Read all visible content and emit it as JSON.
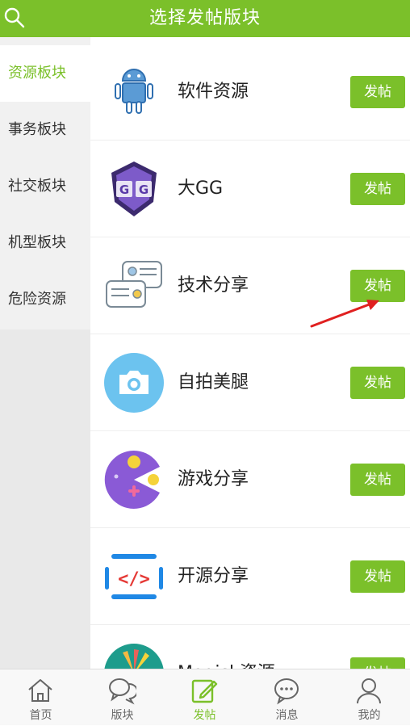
{
  "header": {
    "title": "选择发帖版块",
    "search_icon": "search-icon"
  },
  "sidebar": {
    "items": [
      {
        "label": "资源板块",
        "active": true
      },
      {
        "label": "事务板块",
        "active": false
      },
      {
        "label": "社交板块",
        "active": false
      },
      {
        "label": "机型板块",
        "active": false
      },
      {
        "label": "危险资源",
        "active": false
      }
    ]
  },
  "sections": [
    {
      "label": "软件资源",
      "icon": "android-icon",
      "button": "发帖"
    },
    {
      "label": "大GG",
      "icon": "gg-shield-icon",
      "button": "发帖"
    },
    {
      "label": "技术分享",
      "icon": "chat-cards-icon",
      "button": "发帖"
    },
    {
      "label": "自拍美腿",
      "icon": "camera-icon",
      "button": "发帖"
    },
    {
      "label": "游戏分享",
      "icon": "pacman-icon",
      "button": "发帖"
    },
    {
      "label": "开源分享",
      "icon": "code-icon",
      "button": "发帖"
    },
    {
      "label": "Magisk资源",
      "icon": "magisk-icon",
      "button": "发帖"
    }
  ],
  "tabbar": {
    "items": [
      {
        "label": "首页",
        "icon": "home-icon",
        "active": false
      },
      {
        "label": "版块",
        "icon": "chat-bubbles-icon",
        "active": false
      },
      {
        "label": "发帖",
        "icon": "edit-icon",
        "active": true
      },
      {
        "label": "消息",
        "icon": "message-icon",
        "active": false
      },
      {
        "label": "我的",
        "icon": "user-icon",
        "active": false
      }
    ]
  },
  "colors": {
    "accent": "#7bc02a",
    "sidebar_bg": "#f1f1f1",
    "annotation_arrow": "#e02020"
  }
}
